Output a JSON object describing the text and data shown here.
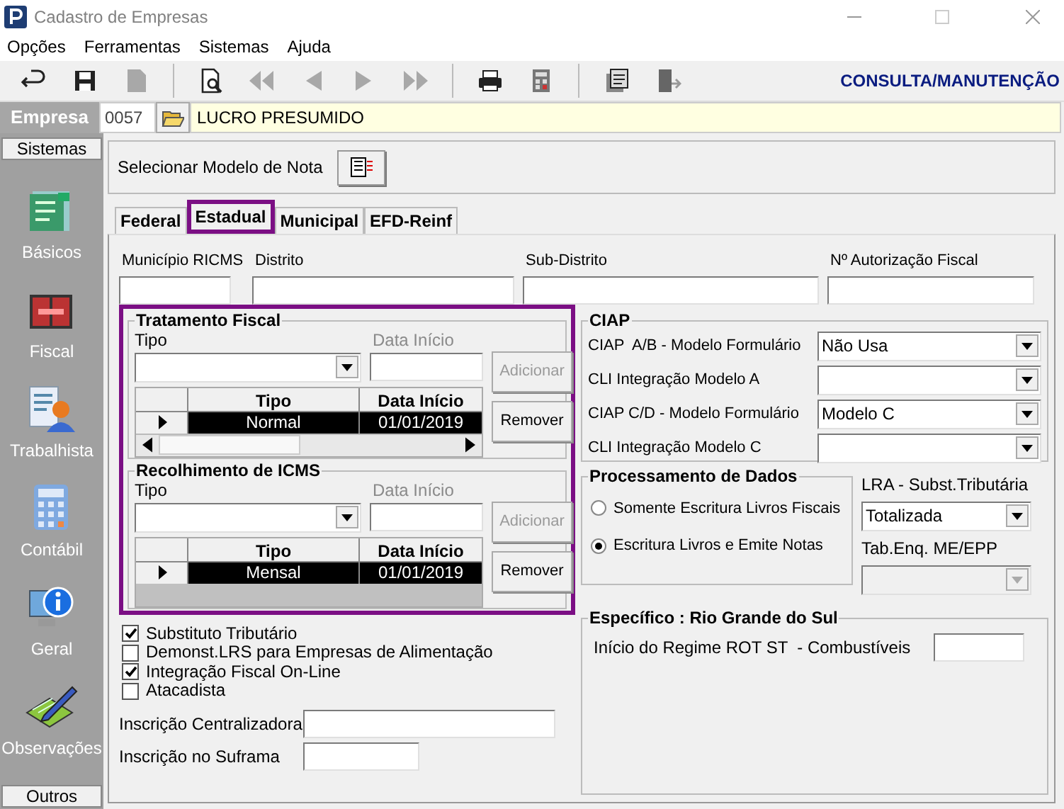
{
  "window": {
    "title": "Cadastro de Empresas"
  },
  "menu": [
    "Opções",
    "Ferramentas",
    "Sistemas",
    "Ajuda"
  ],
  "toolbar": {
    "buttons": [
      {
        "kind": "undo",
        "disabled": false
      },
      {
        "kind": "save",
        "disabled": false
      },
      {
        "kind": "document",
        "disabled": true
      },
      {
        "kind": "sep"
      },
      {
        "kind": "preview",
        "disabled": false
      },
      {
        "kind": "first",
        "disabled": true
      },
      {
        "kind": "prev",
        "disabled": true
      },
      {
        "kind": "next",
        "disabled": true
      },
      {
        "kind": "last",
        "disabled": true
      },
      {
        "kind": "sep"
      },
      {
        "kind": "print",
        "disabled": false
      },
      {
        "kind": "calc",
        "disabled": false
      },
      {
        "kind": "sep"
      },
      {
        "kind": "tools",
        "disabled": false
      },
      {
        "kind": "exit",
        "disabled": false
      }
    ],
    "mode": "CONSULTA/MANUTENÇÃO"
  },
  "empresa": {
    "label": "Empresa",
    "code": "0057",
    "name": "LUCRO PRESUMIDO"
  },
  "sidebar": {
    "header": "Sistemas",
    "items": [
      {
        "label": "Básicos",
        "kind": "basicos"
      },
      {
        "label": "Fiscal",
        "kind": "fiscal"
      },
      {
        "label": "Trabalhista",
        "kind": "trabalhista"
      },
      {
        "label": "Contábil",
        "kind": "contabil"
      },
      {
        "label": "Geral",
        "kind": "geral"
      },
      {
        "label": "Observações",
        "kind": "observacoes"
      }
    ],
    "footer": "Outros"
  },
  "modelo_nota": {
    "label": "Selecionar Modelo de Nota"
  },
  "tabs": [
    {
      "label": "Federal",
      "selected": false
    },
    {
      "label": "Estadual",
      "selected": true
    },
    {
      "label": "Municipal",
      "selected": false
    },
    {
      "label": "EFD-Reinf",
      "selected": false
    }
  ],
  "fields": [
    {
      "label": "Município RICMS"
    },
    {
      "label": "Distrito"
    },
    {
      "label": "Sub-Distrito"
    },
    {
      "label": "Nº Autorização Fiscal"
    }
  ],
  "highlighted": true,
  "groups": [
    {
      "title": "Tratamento Fiscal",
      "tipo_label": "Tipo",
      "date": {
        "label": "Data Início",
        "disabled": true
      },
      "columns": [
        "Tipo",
        "Data Início"
      ],
      "rows": [
        {
          "tipo": "Normal",
          "data": "01/01/2019",
          "selected": true
        }
      ],
      "scrollbar": true,
      "buttons": [
        {
          "label": "Adicionar",
          "disabled": true
        },
        {
          "label": "Remover",
          "disabled": false
        }
      ]
    },
    {
      "title": "Recolhimento de ICMS",
      "tipo_label": "Tipo",
      "date": {
        "label": "Data Início",
        "disabled": true
      },
      "columns": [
        "Tipo",
        "Data Início"
      ],
      "rows": [
        {
          "tipo": "Mensal",
          "data": "01/01/2019",
          "selected": true
        }
      ],
      "scrollbar": false,
      "buttons": [
        {
          "label": "Adicionar",
          "disabled": true
        },
        {
          "label": "Remover",
          "disabled": false
        }
      ]
    }
  ],
  "checkboxes": [
    {
      "label": "Substituto Tributário",
      "checked": true
    },
    {
      "label": "Demonst.LRS para Empresas de Alimentação",
      "checked": false
    },
    {
      "label": "Integração Fiscal On-Line",
      "checked": true
    },
    {
      "label": "Atacadista",
      "checked": false
    }
  ],
  "inscricoes": [
    {
      "label": "Inscrição Centralizadora"
    },
    {
      "label": "Inscrição no Suframa"
    }
  ],
  "ciap": {
    "title": "CIAP",
    "rows": [
      {
        "label": "CIAP  A/B - Modelo Formulário",
        "value": "Não Usa"
      },
      {
        "label": "CLI Integração Modelo A"
      },
      {
        "label": "CIAP C/D - Modelo Formulário",
        "value": "Modelo C"
      },
      {
        "label": "CLI Integração Modelo C"
      }
    ]
  },
  "processamento": {
    "title": "Processamento de Dados",
    "options": [
      {
        "label": "Somente Escritura Livros Fiscais",
        "selected": false
      },
      {
        "label": "Escritura Livros e Emite Notas",
        "selected": true
      }
    ]
  },
  "lra": {
    "label": "LRA - Subst.Tributária",
    "value": "Totalizada"
  },
  "tab_enq": {
    "label": "Tab.Enq. ME/EPP",
    "disabled": true
  },
  "especifico": {
    "title": "Específico : Rio Grande do Sul",
    "label": "Início do Regime ROT ST  - Combustíveis"
  }
}
